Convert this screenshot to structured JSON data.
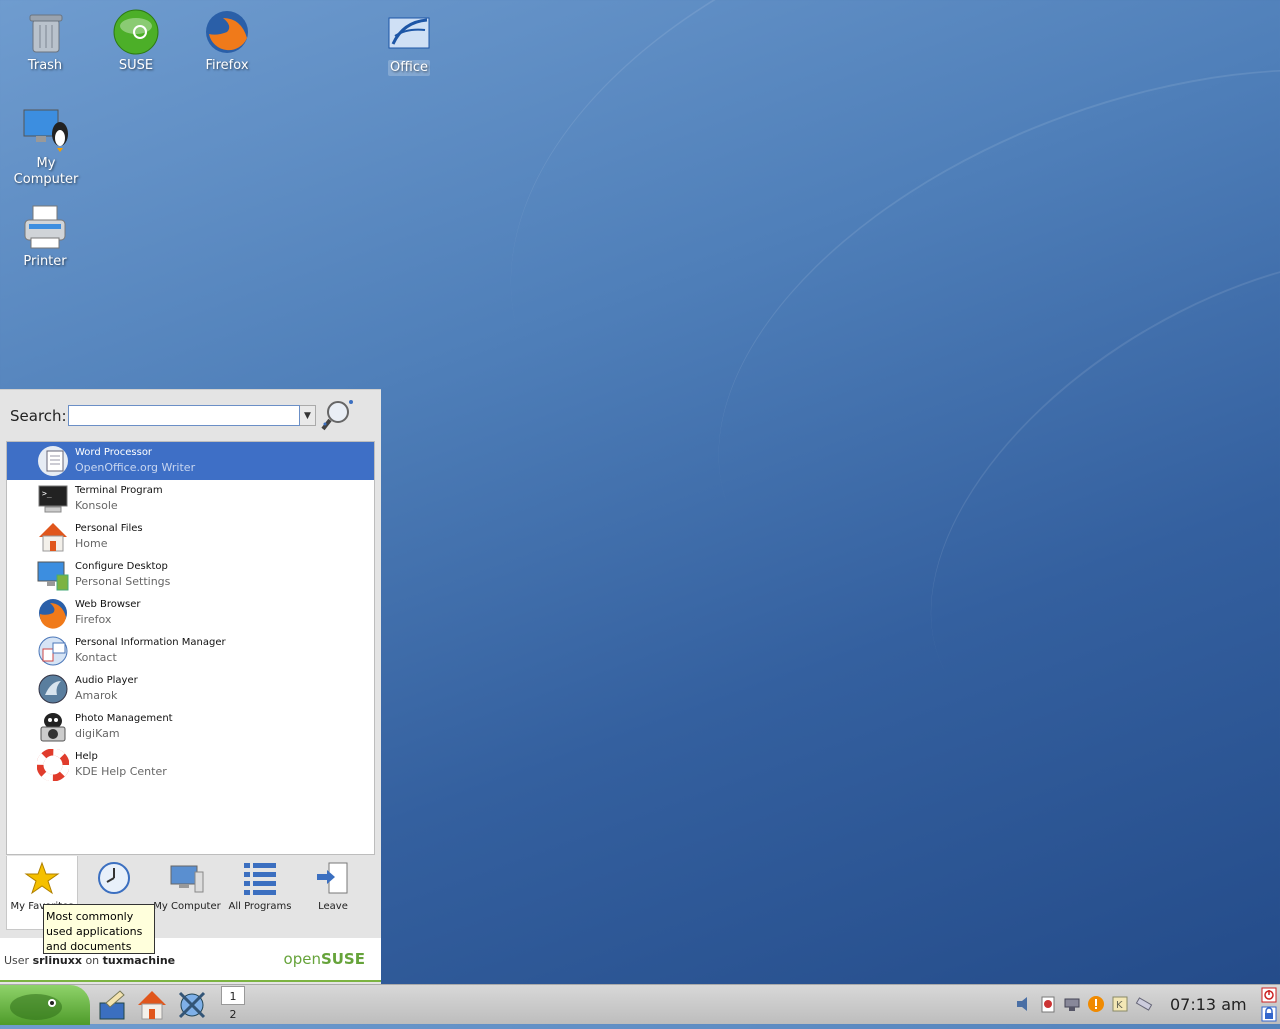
{
  "desktop": {
    "icons": [
      {
        "label": "Trash",
        "icon": "trash-icon"
      },
      {
        "label": "SUSE",
        "icon": "suse-icon"
      },
      {
        "label": "Firefox",
        "icon": "firefox-icon"
      },
      {
        "label": "Office",
        "icon": "office-icon"
      },
      {
        "label": "My Computer",
        "icon": "computer-icon"
      },
      {
        "label": "Printer",
        "icon": "printer-icon"
      }
    ]
  },
  "menu": {
    "search_label": "Search:",
    "search_value": "",
    "favorites": [
      {
        "title": "Word Processor",
        "subtitle": "OpenOffice.org Writer",
        "icon": "writer-icon"
      },
      {
        "title": "Terminal Program",
        "subtitle": "Konsole",
        "icon": "terminal-icon"
      },
      {
        "title": "Personal Files",
        "subtitle": "Home",
        "icon": "home-icon"
      },
      {
        "title": "Configure Desktop",
        "subtitle": "Personal Settings",
        "icon": "settings-icon"
      },
      {
        "title": "Web Browser",
        "subtitle": "Firefox",
        "icon": "firefox-icon"
      },
      {
        "title": "Personal Information Manager",
        "subtitle": "Kontact",
        "icon": "kontact-icon"
      },
      {
        "title": "Audio Player",
        "subtitle": "Amarok",
        "icon": "amarok-icon"
      },
      {
        "title": "Photo Management",
        "subtitle": "digiKam",
        "icon": "digikam-icon"
      },
      {
        "title": "Help",
        "subtitle": "KDE Help Center",
        "icon": "help-icon"
      }
    ],
    "tabs": [
      {
        "label": "My Favorites",
        "icon": "star-icon"
      },
      {
        "label": "",
        "icon": "clock-icon"
      },
      {
        "label": "My Computer",
        "icon": "computer-icon"
      },
      {
        "label": "All Programs",
        "icon": "list-icon"
      },
      {
        "label": "Leave",
        "icon": "leave-icon"
      }
    ],
    "tooltip": "Most commonly used applications and documents",
    "user_prefix": "User",
    "username": "srlinuxx",
    "on_word": "on",
    "hostname": "tuxmachine",
    "brand_open": "open",
    "brand_suse": "SUSE"
  },
  "taskbar": {
    "desktops": [
      "1",
      "2"
    ],
    "clock": "07:13 am"
  }
}
